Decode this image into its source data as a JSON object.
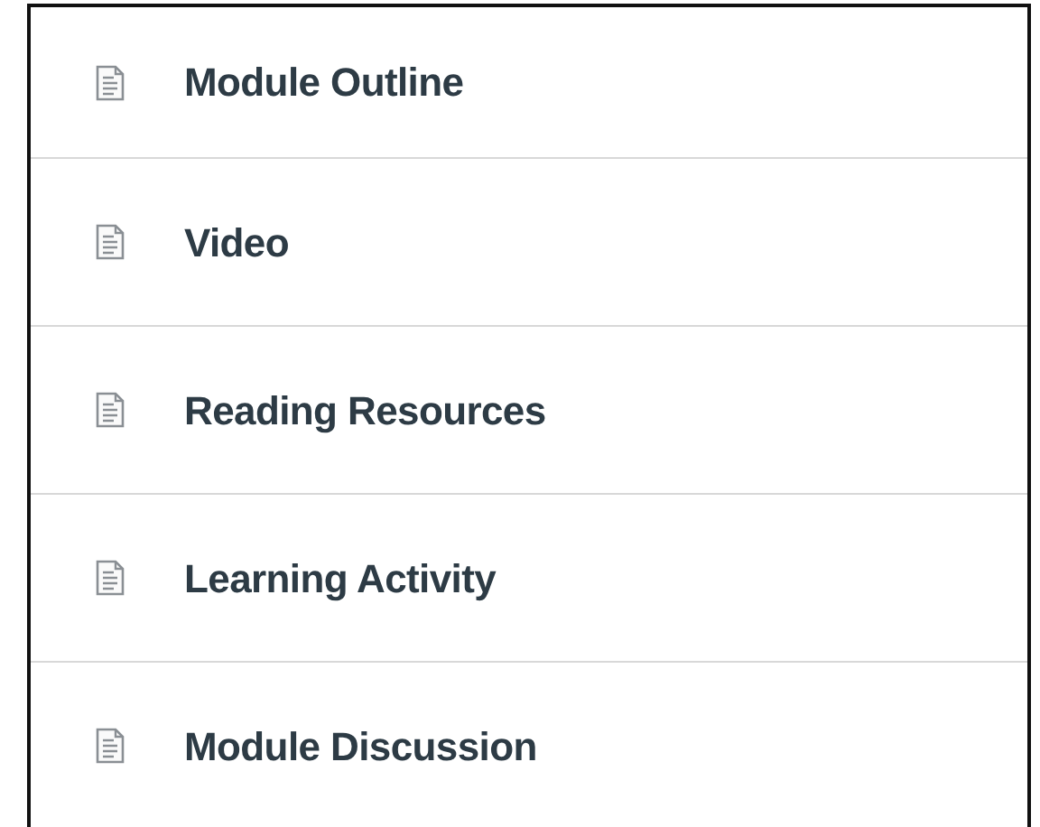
{
  "items": [
    {
      "label": "Module Outline"
    },
    {
      "label": "Video"
    },
    {
      "label": "Reading Resources"
    },
    {
      "label": "Learning Activity"
    },
    {
      "label": "Module Discussion"
    }
  ]
}
